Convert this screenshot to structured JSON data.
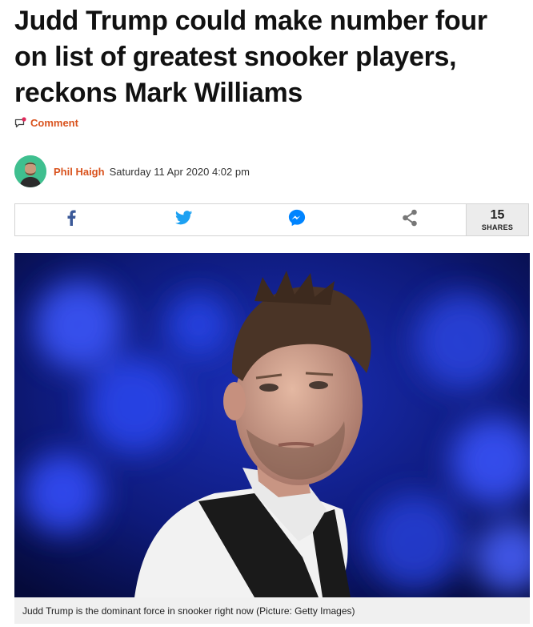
{
  "article": {
    "headline": "Judd Trump could make number four on list of greatest snooker players, reckons Mark Williams",
    "comment_label": "Comment",
    "author": "Phil Haigh",
    "date": "Saturday 11 Apr 2020 4:02 pm"
  },
  "share": {
    "buttons": [
      {
        "name": "facebook",
        "icon": "facebook-icon",
        "color": "#3b5998"
      },
      {
        "name": "twitter",
        "icon": "twitter-icon",
        "color": "#1da1f2"
      },
      {
        "name": "messenger",
        "icon": "messenger-icon",
        "color": "#0084ff"
      },
      {
        "name": "share",
        "icon": "share-icon",
        "color": "#777777"
      }
    ],
    "count": "15",
    "count_label": "SHARES"
  },
  "image": {
    "caption": "Judd Trump is the dominant force in snooker right now (Picture: Getty Images)"
  },
  "colors": {
    "accent": "#d9531e",
    "headline": "#111111"
  }
}
